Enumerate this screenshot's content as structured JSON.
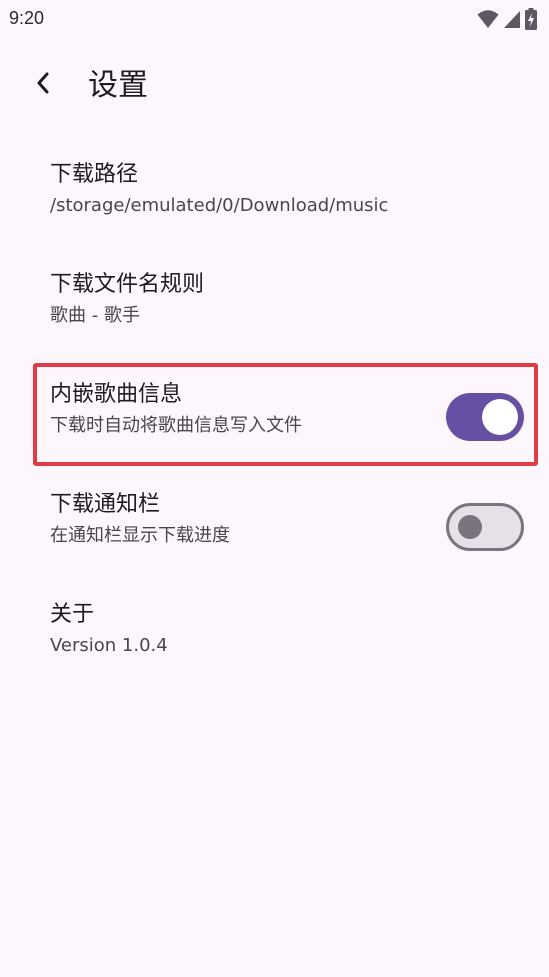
{
  "status_bar": {
    "time": "9:20"
  },
  "app_bar": {
    "title": "设置"
  },
  "settings": {
    "items": [
      {
        "title": "下载路径",
        "subtitle": "/storage/emulated/0/Download/music"
      },
      {
        "title": "下载文件名规则",
        "subtitle": "歌曲 - 歌手"
      },
      {
        "title": "内嵌歌曲信息",
        "subtitle": "下载时自动将歌曲信息写入文件",
        "switch_on": true
      },
      {
        "title": "下载通知栏",
        "subtitle": "在通知栏显示下载进度",
        "switch_on": false
      },
      {
        "title": "关于",
        "subtitle": "Version 1.0.4"
      }
    ]
  },
  "colors": {
    "background": "#FDF7FD",
    "accent": "#6750A4",
    "highlight": "#E03C44"
  },
  "icons": {
    "back": "chevron-left-icon",
    "wifi": "wifi-icon",
    "signal": "signal-icon",
    "battery": "battery-charging-icon"
  }
}
